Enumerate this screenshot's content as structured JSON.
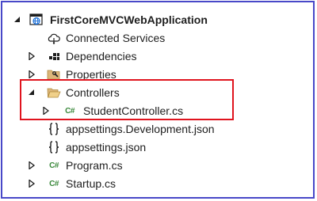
{
  "solution_explorer": {
    "project": {
      "name": "FirstCoreMVCWebApplication",
      "icon": "web-project-icon"
    },
    "items": [
      {
        "label": "Connected Services",
        "icon": "cloud-icon"
      },
      {
        "label": "Dependencies",
        "icon": "dependencies-icon"
      },
      {
        "label": "Properties",
        "icon": "folder-wrench-icon"
      },
      {
        "label": "Controllers",
        "icon": "folder-open-icon"
      },
      {
        "label": "StudentController.cs",
        "icon": "csharp-file-icon"
      },
      {
        "label": "appsettings.Development.json",
        "icon": "json-file-icon"
      },
      {
        "label": "appsettings.json",
        "icon": "json-file-icon"
      },
      {
        "label": "Program.cs",
        "icon": "csharp-file-icon"
      },
      {
        "label": "Startup.cs",
        "icon": "csharp-file-icon"
      }
    ],
    "cs_badge": "C#"
  },
  "colors": {
    "frame": "#4848c8",
    "highlight": "#e0141e",
    "csharp": "#39883a"
  }
}
